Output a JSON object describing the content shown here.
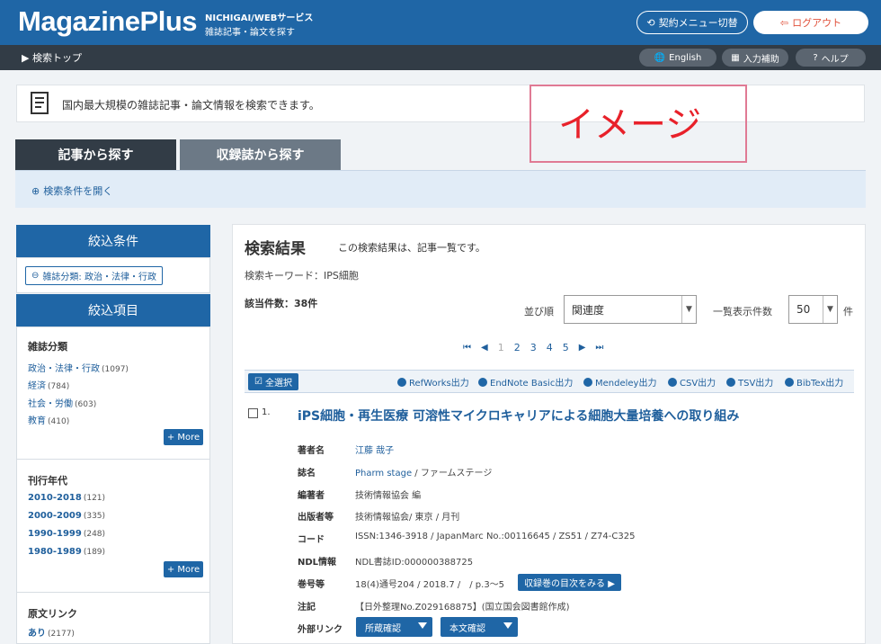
{
  "header": {
    "logo": "MagazinePlus",
    "subtitle1": "NICHIGAI/WEBサービス",
    "subtitle2": "雑誌記事・論文を探す",
    "contract_label": "契約メニュー切替",
    "logout_label": "ログアウト"
  },
  "subbar": {
    "breadcrumb": "▶ 検索トップ",
    "english_label": "English",
    "input_help_label": "入力補助",
    "help_label": "ヘルプ"
  },
  "info": {
    "text": "国内最大規模の雑誌記事・論文情報を検索できます。",
    "image_overlay": "イメージ"
  },
  "tabs": [
    {
      "label": "記事から探す",
      "active": true
    },
    {
      "label": "収録誌から探す",
      "active": false
    }
  ],
  "conditions": {
    "open_label": "検索条件を開く"
  },
  "sidebar": {
    "refine_header": "絞込条件",
    "active_filter": "雑誌分類: 政治・法律・行政",
    "items_header": "絞込項目",
    "groups": [
      {
        "title": "雑誌分類",
        "items": [
          {
            "label": "政治・法律・行政",
            "count": "(1097)"
          },
          {
            "label": "経済",
            "count": "(784)"
          },
          {
            "label": "社会・労働",
            "count": "(603)"
          },
          {
            "label": "教育",
            "count": "(410)"
          }
        ],
        "more": "+ More"
      },
      {
        "title": "刊行年代",
        "items": [
          {
            "label": "2010-2018",
            "count": "(121)"
          },
          {
            "label": "2000-2009",
            "count": "(335)"
          },
          {
            "label": "1990-1999",
            "count": "(248)"
          },
          {
            "label": "1980-1989",
            "count": "(189)"
          }
        ],
        "more": "+ More"
      },
      {
        "title": "原文リンク",
        "items": [
          {
            "label": "あり",
            "count": "(2177)"
          }
        ]
      }
    ]
  },
  "results": {
    "title": "検索結果",
    "note": "この検索結果は、記事一覧です。",
    "keyword": "検索キーワード：IPS細胞",
    "hits": "該当件数：38件",
    "sort_label": "並び順",
    "sort_value": "関連度",
    "perpage_label": "一覧表示件数",
    "perpage_value": "50",
    "perpage_unit": "件",
    "pages": [
      "1",
      "2",
      "3",
      "4",
      "5"
    ],
    "current_page": "1",
    "select_all": "全選択",
    "exports": [
      "RefWorks出力",
      "EndNote Basic出力",
      "Mendeley出力",
      "CSV出力",
      "TSV出力",
      "BibTex出力"
    ]
  },
  "record": {
    "number": "1.",
    "title": "iPS細胞・再生医療 可溶性マイクロキャリアによる細胞大量培養への取り組み",
    "fields": {
      "author_label": "著者名",
      "author": "江藤 哉子",
      "journal_label": "誌名",
      "journal_link": "Pharm stage",
      "journal_rest": " / ファームステージ",
      "editor_label": "編著者",
      "editor": "技術情報協会 編",
      "publisher_label": "出版者等",
      "publisher": "技術情報協会/ 東京 / 月刊",
      "code_label": "コード",
      "code": "ISSN:1346-3918 / JapanMarc No.:00116645 / ZS51 / Z74-C325",
      "ndl_label": "NDL情報",
      "ndl": "NDL書誌ID:000000388725",
      "volume_label": "巻号等",
      "volume": "18(4)通号204 / 2018.7 /　/ p.3〜5",
      "note_label": "注記",
      "note": "【日外整理No.Z029168875】(国立国会図書館作成)",
      "extlink_label": "外部リンク"
    },
    "toc_button": "収録巻の目次をみる ▶",
    "holdings_button": "所蔵確認",
    "fulltext_button": "本文確認"
  }
}
